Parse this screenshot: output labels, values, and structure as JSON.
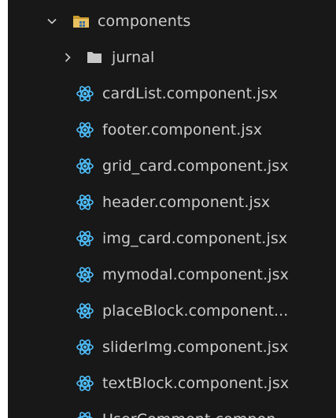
{
  "explorer": {
    "colors": {
      "background": "#181818",
      "text": "#cccccc",
      "react_icon": "#4fc1ff",
      "folder_open": "#e8c060",
      "folder_closed": "#c8c8c8"
    },
    "root_folder": {
      "name": "components",
      "expanded": true,
      "icon": "folder-open-icon"
    },
    "subfolder": {
      "name": "jurnal",
      "expanded": false,
      "icon": "folder-closed-icon"
    },
    "files": [
      {
        "name": "cardList.component.jsx",
        "icon": "react-icon"
      },
      {
        "name": "footer.component.jsx",
        "icon": "react-icon"
      },
      {
        "name": "grid_card.component.jsx",
        "icon": "react-icon"
      },
      {
        "name": "header.component.jsx",
        "icon": "react-icon"
      },
      {
        "name": "img_card.component.jsx",
        "icon": "react-icon"
      },
      {
        "name": "mymodal.component.jsx",
        "icon": "react-icon"
      },
      {
        "name": "placeBlock.component...",
        "icon": "react-icon"
      },
      {
        "name": "sliderImg.component.jsx",
        "icon": "react-icon"
      },
      {
        "name": "textBlock.component.jsx",
        "icon": "react-icon"
      },
      {
        "name": "UserComment.compon...",
        "icon": "react-icon"
      }
    ]
  }
}
